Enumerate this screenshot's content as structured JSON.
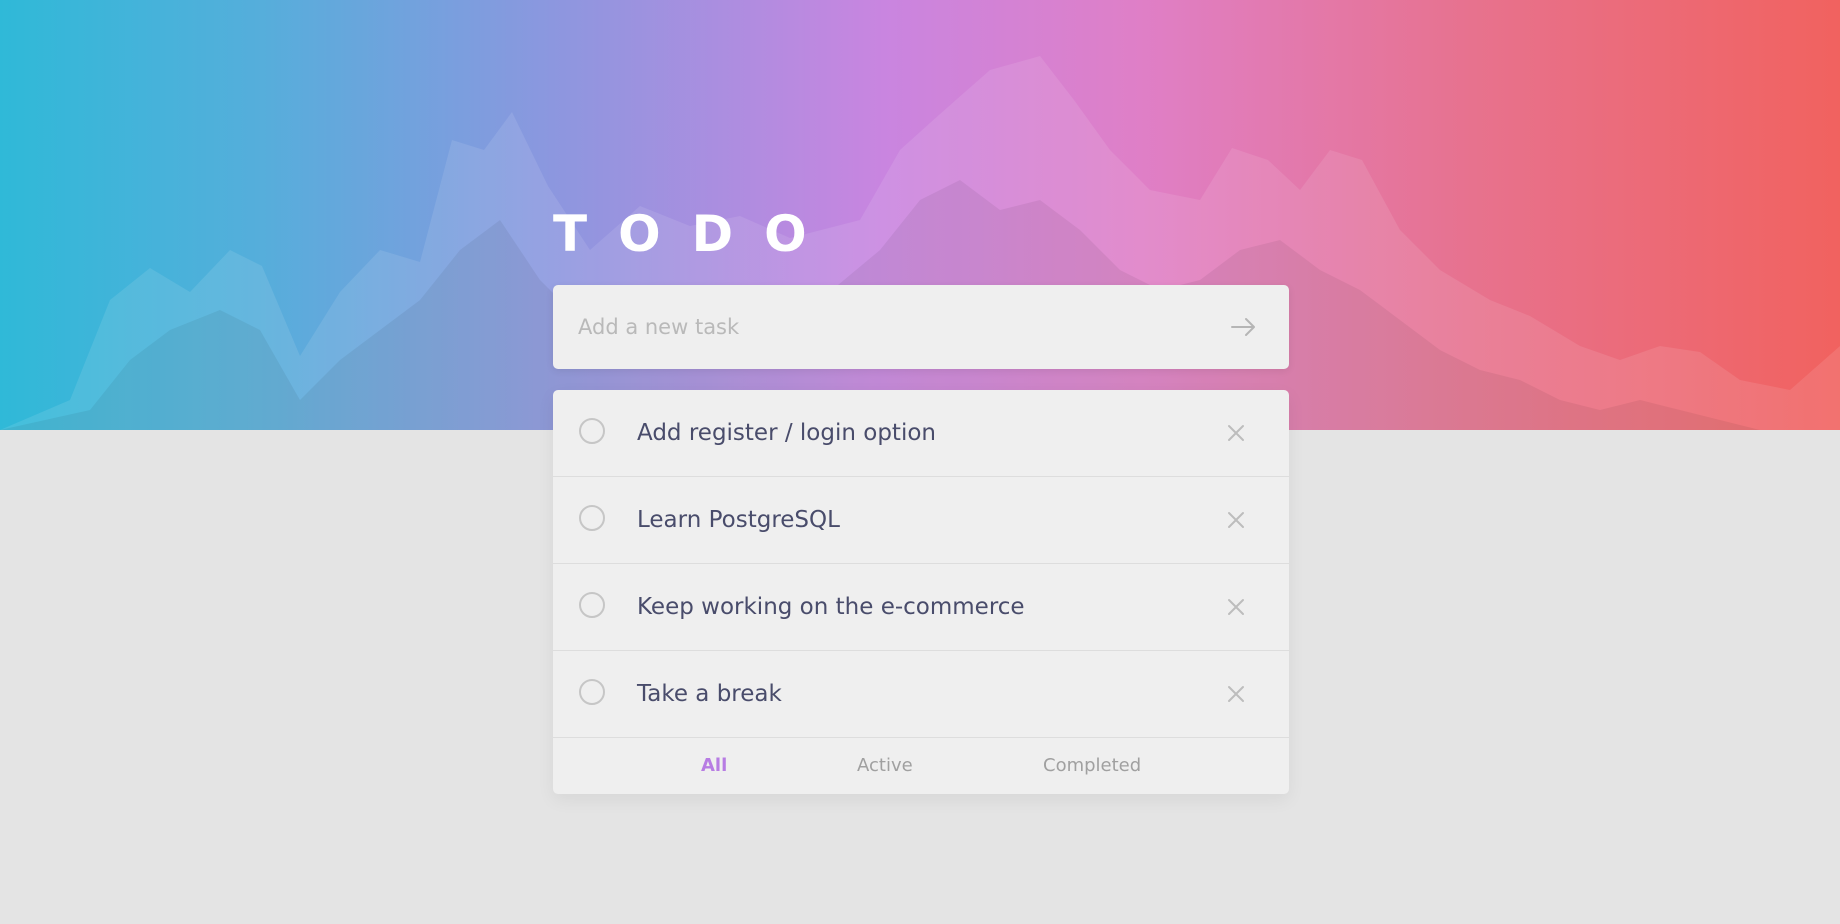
{
  "app": {
    "title": "TODO"
  },
  "new_task": {
    "placeholder": "Add a new task",
    "submit_icon": "arrow-right-icon"
  },
  "todos": [
    {
      "text": "Add register / login option",
      "completed": false
    },
    {
      "text": "Learn PostgreSQL",
      "completed": false
    },
    {
      "text": "Keep working on the e-commerce",
      "completed": false
    },
    {
      "text": "Take a break",
      "completed": false
    }
  ],
  "filters": {
    "all": "All",
    "active": "Active",
    "completed": "Completed",
    "selected": "all"
  },
  "icons": {
    "check": "circle-checkbox-icon",
    "delete": "close-icon"
  },
  "colors": {
    "background": "#e4e4e4",
    "card": "#efefef",
    "text": "#494c6b",
    "accent": "#b77ce3",
    "muted": "#a0a0a0",
    "gradient": [
      "#2fb9d8",
      "#8c97df",
      "#c985e0",
      "#df7fc7",
      "#f1625f"
    ]
  }
}
